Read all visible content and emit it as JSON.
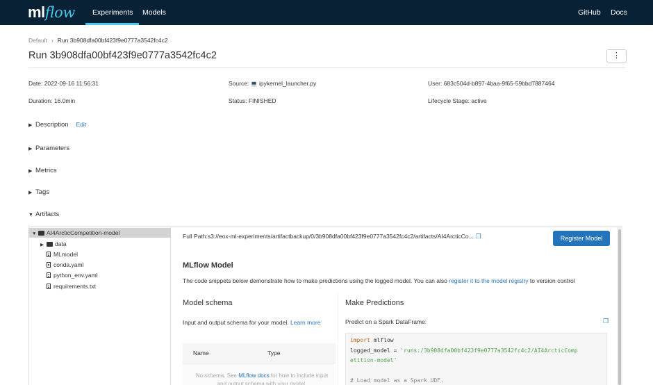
{
  "nav": {
    "logo_ml": "ml",
    "logo_flow": "flow",
    "experiments": "Experiments",
    "models": "Models",
    "github": "GitHub",
    "docs": "Docs"
  },
  "breadcrumb": {
    "parent": "Default",
    "current": "Run 3b908dfa00bf423f9e0777a3542fc4c2"
  },
  "page_title": "Run 3b908dfa00bf423f9e0777a3542fc4c2",
  "more_label": "⋮",
  "meta": {
    "date_label": "Date:",
    "date_value": "2022-09-16 11:56:31",
    "source_label": "Source:",
    "source_value": "ipykernel_launcher.py",
    "user_label": "User:",
    "user_value": "683c504d-b897-4baa-9f65-59bbd7887464",
    "duration_label": "Duration:",
    "duration_value": "16.0min",
    "status_label": "Status:",
    "status_value": "FINISHED",
    "lifecycle_label": "Lifecycle Stage:",
    "lifecycle_value": "active"
  },
  "sections": {
    "description": "Description",
    "edit": "Edit",
    "parameters": "Parameters",
    "metrics": "Metrics",
    "tags": "Tags",
    "artifacts": "Artifacts"
  },
  "tree": {
    "root": "AI4ArcticCompetition-model",
    "data": "data",
    "files": [
      "MLmodel",
      "conda.yaml",
      "python_env.yaml",
      "requirements.txt"
    ]
  },
  "detail": {
    "full_path": "Full Path:s3://eox-ml-experiments/artifactbackup/0/3b908dfa00bf423f9e0777a3542fc4c2/artifacts/AI4ArcticCo...",
    "register_button": "Register Model",
    "mlflow_model_title": "MLflow Model",
    "desc_before": "The code snippets below demonstrate how to make predictions using the logged model. You can also ",
    "desc_link": "register it to the model registry",
    "desc_after": " to version control",
    "schema_title": "Model schema",
    "schema_desc": "Input and output schema for your model. ",
    "schema_learn_more": "Learn more",
    "col_name": "Name",
    "col_type": "Type",
    "noschema_before": "No schema. See ",
    "noschema_link": "MLflow docs",
    "noschema_after": " for how to include input and output schema with your model.",
    "pred_title": "Make Predictions",
    "pred_sub": "Predict on a Spark DataFrame:",
    "code_import_kw": "import",
    "code_import_rest": " mlflow",
    "code_logged_prefix": "logged_model = ",
    "code_logged_str1": "'runs:/3b908dfa00bf423f9e0777a3542fc4c2/AI4ArcticComp",
    "code_logged_str2": "etition-model'",
    "code_comment": "# Load model as a Spark UDF."
  },
  "icons": {
    "copy": "copy-icon",
    "file": "file-icon",
    "folder": "folder-icon",
    "more": "more-vertical-icon",
    "caret_right": "caret-right-icon",
    "caret_down": "caret-down-icon"
  },
  "colors": {
    "nav_bg": "#082135",
    "accent": "#43c9ed",
    "link": "#2374bb",
    "button": "#2374bb"
  }
}
